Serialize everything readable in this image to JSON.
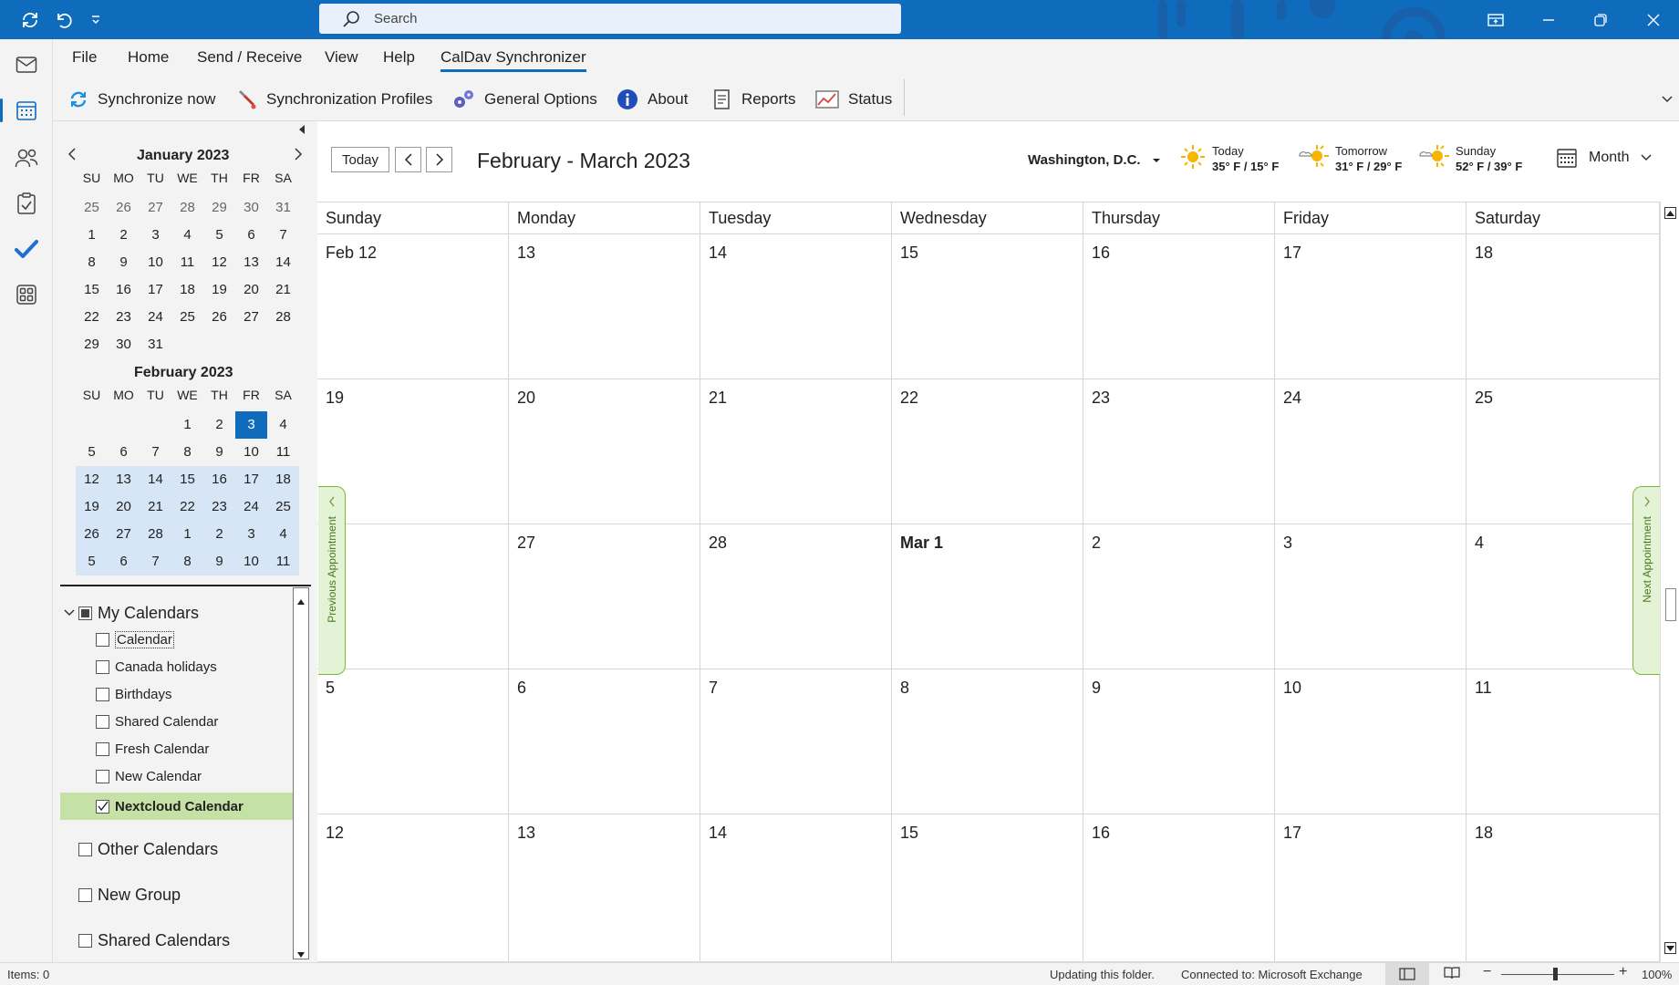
{
  "titlebar": {
    "search_placeholder": "Search",
    "icons": [
      "sync-icon",
      "undo-icon",
      "quick-access-dropdown-icon",
      "search-icon",
      "ribbon-display-icon",
      "minimize-icon",
      "restore-icon",
      "close-icon"
    ]
  },
  "rail": {
    "icons": [
      "mail-icon",
      "calendar-icon",
      "people-icon",
      "tasks-icon",
      "todo-icon",
      "apps-icon"
    ],
    "active": "calendar-icon"
  },
  "ribbon": {
    "tabs": [
      "File",
      "Home",
      "Send / Receive",
      "View",
      "Help",
      "CalDav Synchronizer"
    ],
    "active_tab": "CalDav Synchronizer",
    "buttons": [
      "Synchronize now",
      "Synchronization Profiles",
      "General Options",
      "About",
      "Reports",
      "Status"
    ]
  },
  "mini_calendar": {
    "dow": [
      "SU",
      "MO",
      "TU",
      "WE",
      "TH",
      "FR",
      "SA"
    ],
    "january": {
      "title": "January 2023",
      "weeks": [
        [
          "25",
          "26",
          "27",
          "28",
          "29",
          "30",
          "31"
        ],
        [
          "1",
          "2",
          "3",
          "4",
          "5",
          "6",
          "7"
        ],
        [
          "8",
          "9",
          "10",
          "11",
          "12",
          "13",
          "14"
        ],
        [
          "15",
          "16",
          "17",
          "18",
          "19",
          "20",
          "21"
        ],
        [
          "22",
          "23",
          "24",
          "25",
          "26",
          "27",
          "28"
        ],
        [
          "29",
          "30",
          "31",
          "",
          "",
          "",
          ""
        ]
      ]
    },
    "february": {
      "title": "February 2023",
      "weeks": [
        [
          "",
          "",
          "",
          "1",
          "2",
          "3",
          "4"
        ],
        [
          "5",
          "6",
          "7",
          "8",
          "9",
          "10",
          "11"
        ],
        [
          "12",
          "13",
          "14",
          "15",
          "16",
          "17",
          "18"
        ],
        [
          "19",
          "20",
          "21",
          "22",
          "23",
          "24",
          "25"
        ],
        [
          "26",
          "27",
          "28",
          "1",
          "2",
          "3",
          "4"
        ],
        [
          "5",
          "6",
          "7",
          "8",
          "9",
          "10",
          "11"
        ]
      ],
      "today": "3"
    }
  },
  "calendars": {
    "group_my": "My Calendars",
    "items": [
      {
        "label": "Calendar",
        "checked": false
      },
      {
        "label": "Canada holidays",
        "checked": false
      },
      {
        "label": "Birthdays",
        "checked": false
      },
      {
        "label": "Shared Calendar",
        "checked": false
      },
      {
        "label": "Fresh Calendar",
        "checked": false
      },
      {
        "label": "New Calendar",
        "checked": false
      },
      {
        "label": "Nextcloud Calendar",
        "checked": true
      }
    ],
    "other_groups": [
      "Other Calendars",
      "New Group",
      "Shared Calendars"
    ]
  },
  "calendar_header": {
    "today_button": "Today",
    "range_title": "February - March 2023",
    "location": "Washington,  D.C.",
    "weather": [
      {
        "day": "Today",
        "temp": "35° F / 15° F",
        "icon": "sunny-icon"
      },
      {
        "day": "Tomorrow",
        "temp": "31° F / 29° F",
        "icon": "partly-sunny-icon"
      },
      {
        "day": "Sunday",
        "temp": "52° F / 39° F",
        "icon": "partly-sunny-icon"
      }
    ],
    "view": "Month"
  },
  "month_grid": {
    "dow": [
      "Sunday",
      "Monday",
      "Tuesday",
      "Wednesday",
      "Thursday",
      "Friday",
      "Saturday"
    ],
    "weeks": [
      [
        "Feb 12",
        "13",
        "14",
        "15",
        "16",
        "17",
        "18"
      ],
      [
        "19",
        "20",
        "21",
        "22",
        "23",
        "24",
        "25"
      ],
      [
        "",
        "27",
        "28",
        "Mar 1",
        "2",
        "3",
        "4"
      ],
      [
        "5",
        "6",
        "7",
        "8",
        "9",
        "10",
        "11"
      ],
      [
        "12",
        "13",
        "14",
        "15",
        "16",
        "17",
        "18"
      ]
    ],
    "bold_cell": "Mar 1",
    "prev_appointment": "Previous Appointment",
    "next_appointment": "Next Appointment"
  },
  "statusbar": {
    "items": "Items: 0",
    "updating": "Updating this folder.",
    "connected": "Connected to: Microsoft Exchange",
    "zoom": "100%"
  },
  "colors": {
    "accent": "#0f6cbd",
    "selection": "#d6e6f7",
    "highlight_green": "#c5e1a5",
    "appt_tab": "#e4f3d5"
  }
}
